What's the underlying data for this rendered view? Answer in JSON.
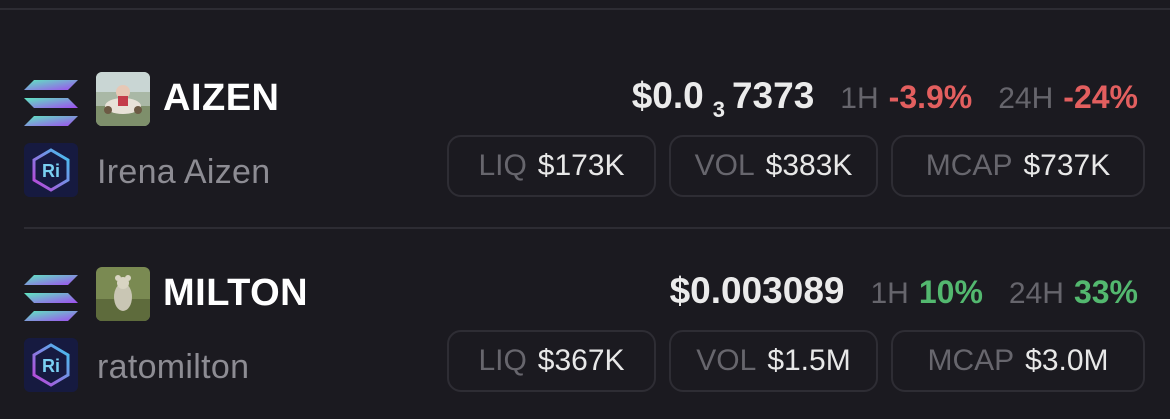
{
  "tokens": [
    {
      "chain_icon": "solana-icon",
      "dex_icon": "raydium-icon",
      "symbol": "AIZEN",
      "name": "Irena Aizen",
      "price_prefix": "$0.0",
      "price_zero_count": "3",
      "price_suffix": "7373",
      "h1_label": "1H",
      "h1_change": "-3.9%",
      "h24_label": "24H",
      "h24_change": "-24%",
      "liq_label": "LIQ",
      "liq_value": "$173K",
      "vol_label": "VOL",
      "vol_value": "$383K",
      "mcap_label": "MCAP",
      "mcap_value": "$737K"
    },
    {
      "chain_icon": "solana-icon",
      "dex_icon": "raydium-icon",
      "symbol": "MILTON",
      "name": "ratomilton",
      "price": "$0.003089",
      "h1_label": "1H",
      "h1_change": "10%",
      "h24_label": "24H",
      "h24_change": "33%",
      "liq_label": "LIQ",
      "liq_value": "$367K",
      "vol_label": "VOL",
      "vol_value": "$1.5M",
      "mcap_label": "MCAP",
      "mcap_value": "$3.0M"
    }
  ],
  "colors": {
    "background": "#1b1a20",
    "negative": "#e35f5f",
    "positive": "#53b86f",
    "muted": "#67666d"
  }
}
